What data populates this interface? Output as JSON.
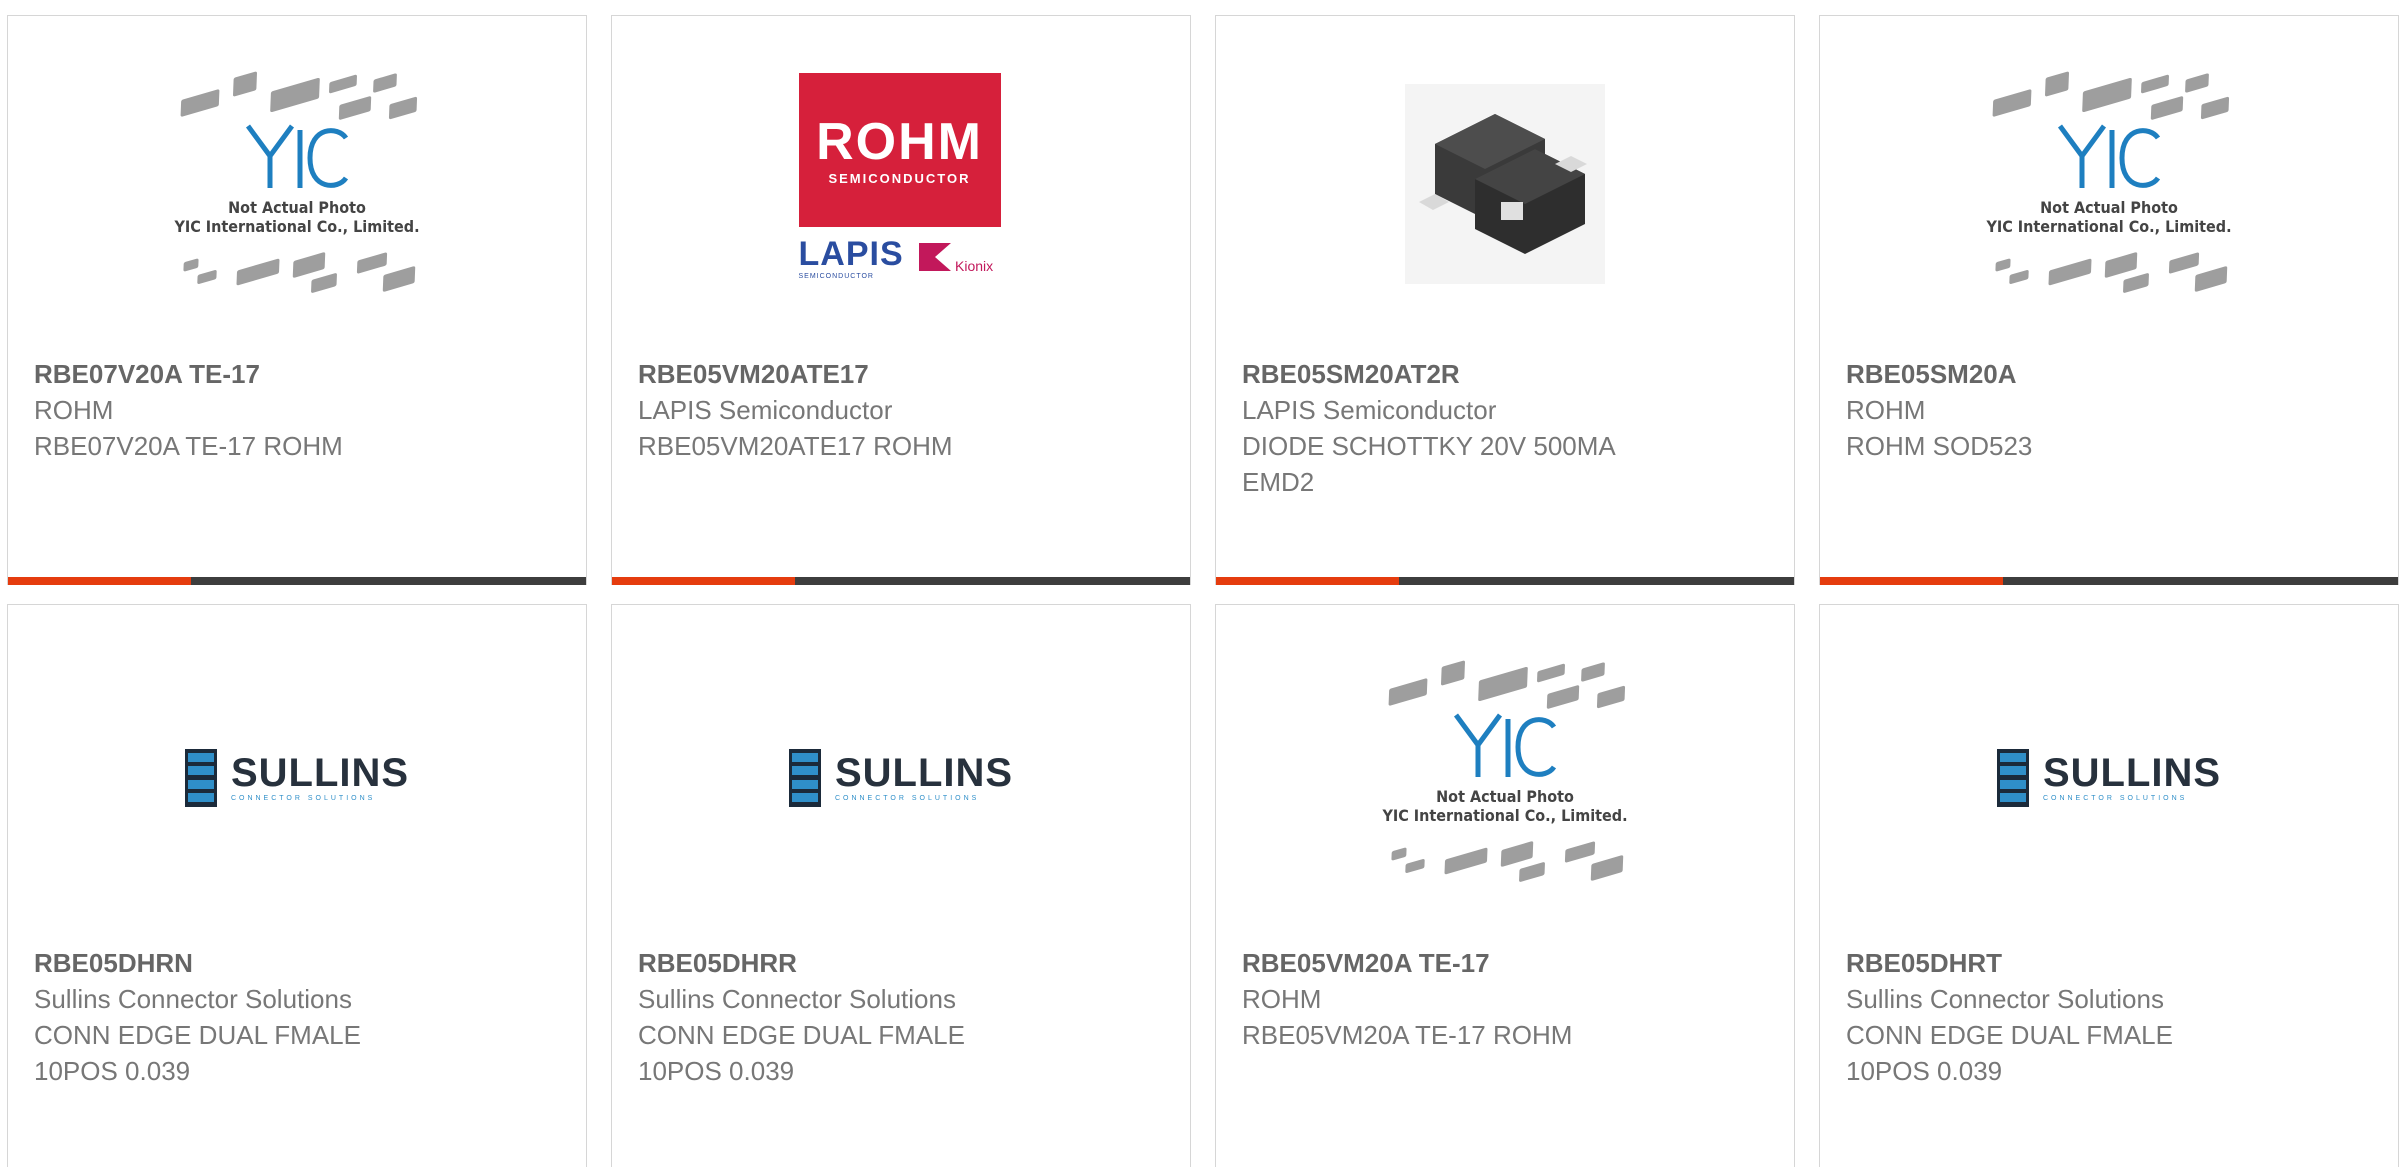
{
  "colors": {
    "accent_bar": "#e53c0e",
    "dark_bar": "#3d3d3d",
    "card_border": "#d6d6d6"
  },
  "placeholder": {
    "line1": "Not Actual Photo",
    "line2": "YIC International Co., Limited.",
    "logo": "YIC"
  },
  "logos": {
    "rohm": {
      "name": "ROHM",
      "tagline": "SEMICONDUCTOR",
      "lapis": "LAPIS",
      "lapis_sub": "SEMICONDUCTOR",
      "kionix": "Kionix"
    },
    "sullins": {
      "name": "SULLINS",
      "tagline": "CONNECTOR SOLUTIONS"
    }
  },
  "products": [
    {
      "part_number": "RBE07V20A TE-17",
      "manufacturer": "ROHM",
      "description": "RBE07V20A TE-17 ROHM",
      "image": "yic-placeholder"
    },
    {
      "part_number": "RBE05VM20ATE17",
      "manufacturer": "LAPIS Semiconductor",
      "description": "RBE05VM20ATE17 ROHM",
      "image": "rohm-logo"
    },
    {
      "part_number": "RBE05SM20AT2R",
      "manufacturer": "LAPIS Semiconductor",
      "description": "DIODE SCHOTTKY 20V 500MA EMD2",
      "image": "diode-photo"
    },
    {
      "part_number": "RBE05SM20A",
      "manufacturer": "ROHM",
      "description": "ROHM SOD523",
      "image": "yic-placeholder"
    },
    {
      "part_number": "RBE05DHRN",
      "manufacturer": "Sullins Connector Solutions",
      "description": "CONN EDGE DUAL FMALE 10POS 0.039",
      "image": "sullins-logo"
    },
    {
      "part_number": "RBE05DHRR",
      "manufacturer": "Sullins Connector Solutions",
      "description": "CONN EDGE DUAL FMALE 10POS 0.039",
      "image": "sullins-logo"
    },
    {
      "part_number": "RBE05VM20A TE-17",
      "manufacturer": "ROHM",
      "description": "RBE05VM20A TE-17 ROHM",
      "image": "yic-placeholder"
    },
    {
      "part_number": "RBE05DHRT",
      "manufacturer": "Sullins Connector Solutions",
      "description": "CONN EDGE DUAL FMALE 10POS 0.039",
      "image": "sullins-logo"
    }
  ]
}
